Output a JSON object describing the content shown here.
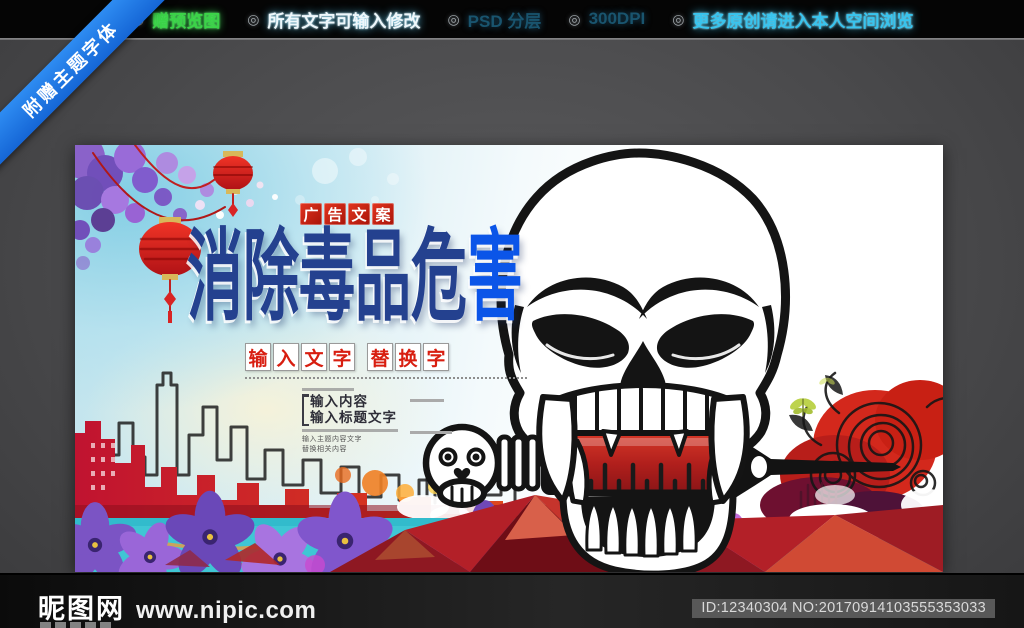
{
  "ribbon": {
    "label": "附赠主题字体"
  },
  "topbar": {
    "bullet": "◎",
    "items": [
      {
        "label": "赠预览图"
      },
      {
        "label": "所有文字可输入修改"
      },
      {
        "label": "PSD 分层"
      },
      {
        "label": "300DPI"
      },
      {
        "label": "更多原创请进入本人空间浏览"
      }
    ]
  },
  "poster": {
    "stamp_chars": [
      "广",
      "告",
      "文",
      "案"
    ],
    "title_main": "消除毒品危",
    "title_accent": "害",
    "box_group1": [
      "输",
      "入",
      "文",
      "字"
    ],
    "box_group2": [
      "替",
      "换",
      "字"
    ],
    "copy_block": {
      "line1": "输入内容",
      "line2": "输入标题文字",
      "line3": "输入主题内容文字",
      "line4": "替换相关内容"
    }
  },
  "footer": {
    "site_name": "昵图网",
    "site_url": "www.nipic.com",
    "id_text": "ID:12340304 NO:20170914103555353033"
  },
  "colors": {
    "ribbon_blue": "#1b7ce8",
    "topbar_green": "#3bd348",
    "topbar_cyan": "#38c4ee",
    "title_navy": "#24418f",
    "title_accent_blue": "#0b55e8",
    "stamp_red": "#c8281e",
    "box_char_red": "#d81e10",
    "flower_band_cyan": "#3fc6d4",
    "syringe_red": "#b02019"
  }
}
